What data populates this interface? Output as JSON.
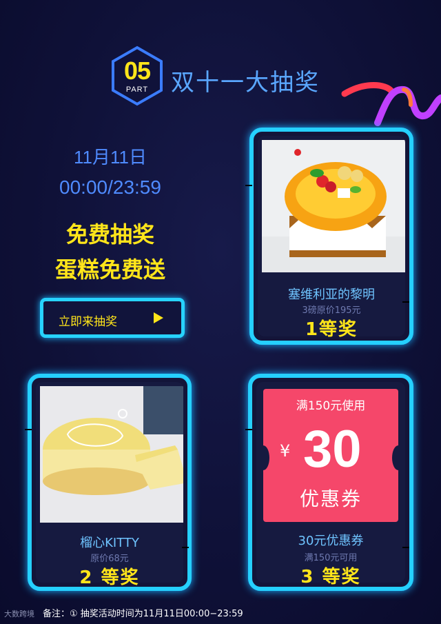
{
  "header": {
    "part_number": "05",
    "part_label": "PART",
    "title": "双十一大抽奖"
  },
  "event": {
    "date": "11月11日",
    "time": "00:00/23:59",
    "promo_line1": "免费抽奖",
    "promo_line2": "蛋糕免费送",
    "draw_button_label": "立即来抽奖"
  },
  "prizes": [
    {
      "name": "塞维利亚的黎明",
      "detail": "3磅原价195元",
      "rank": "1等奖"
    },
    {
      "name": "榴心KITTY",
      "detail": "原价68元",
      "rank": "2 等奖"
    },
    {
      "name": "30元优惠券",
      "detail": "满150元可用",
      "rank": "3 等奖"
    }
  ],
  "coupon": {
    "condition": "满150元使用",
    "currency": "¥",
    "amount": "30",
    "type": "优惠券"
  },
  "footer": {
    "note": "备注：① 抽奖活动时间为11月11日00:00−23:59",
    "watermark": "大数跨境"
  },
  "colors": {
    "accent_yellow": "#ffe51a",
    "neon_cyan": "#25d0ff",
    "title_blue": "#5aa7ff",
    "coupon_red": "#f5476a"
  }
}
